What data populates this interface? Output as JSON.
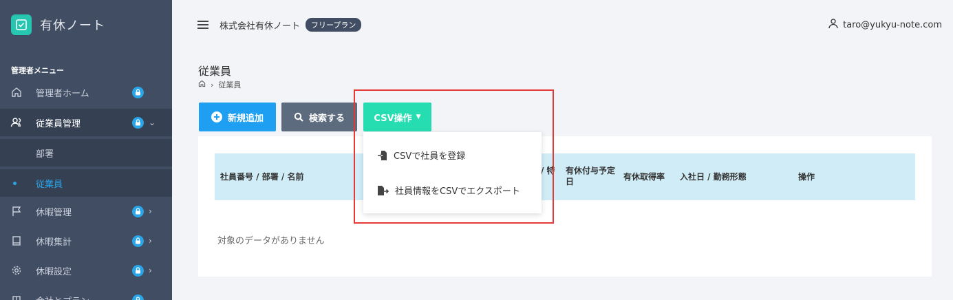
{
  "brand": {
    "name": "有休ノート",
    "logo_icon": "check-square-icon",
    "accent": "#26c6b0"
  },
  "sidebar": {
    "section_label": "管理者メニュー",
    "items": [
      {
        "label": "管理者ホーム",
        "icon": "home-icon"
      },
      {
        "label": "従業員管理",
        "icon": "users-icon"
      },
      {
        "label": "休暇管理",
        "icon": "flag-icon"
      },
      {
        "label": "休暇集計",
        "icon": "book-icon"
      },
      {
        "label": "休暇設定",
        "icon": "gear-icon"
      },
      {
        "label": "会社とプラン",
        "icon": "building-icon"
      }
    ],
    "sub_items": [
      {
        "label": "部署"
      },
      {
        "label": "従業員"
      }
    ]
  },
  "header": {
    "company": "株式会社有休ノート",
    "plan": "フリープラン",
    "user_email": "taro@yukyu-note.com"
  },
  "page": {
    "title": "従業員",
    "breadcrumb_current": "従業員"
  },
  "toolbar": {
    "add_label": "新規追加",
    "search_label": "検索する",
    "csv_label": "CSV操作"
  },
  "dropdown": {
    "import_label": "CSVで社員を登録",
    "export_label": "社員情報をCSVでエクスポート"
  },
  "table": {
    "col_name": "社員番号 / 部署 / 名前",
    "col_partial": "/ 特",
    "col_grant_line1": "有休付与予定",
    "col_grant_line2": "日",
    "col_rate": "有休取得率",
    "col_join": "入社日 / 勤務形態",
    "col_action": "操作",
    "empty_message": "対象のデータがありません"
  },
  "colors": {
    "sidebar_bg": "#414d63",
    "primary": "#1e9ff2",
    "secondary": "#5d6b7e",
    "success": "#26dcb1",
    "highlight": "#e53935"
  }
}
